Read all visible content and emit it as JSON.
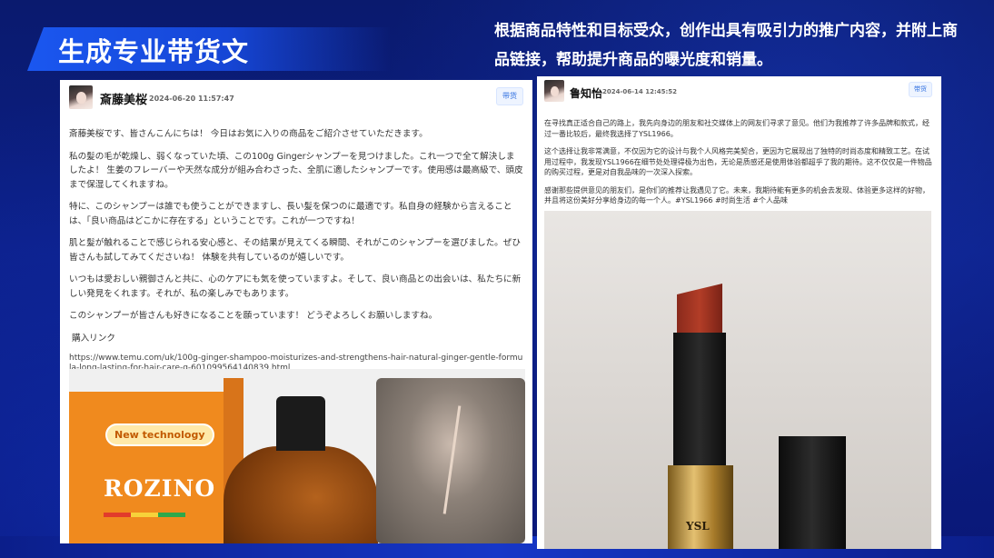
{
  "slide": {
    "title": "生成专业带货文",
    "description": "根据商品特性和目标受众，创作出具有吸引力的推广内容，并附上商品链接，帮助提升商品的曝光度和销量。"
  },
  "left_post": {
    "user_name": "斎藤美桜",
    "timestamp": "2024-06-20 11:57:47",
    "tag_label": "带货",
    "paragraphs": [
      "斎藤美桜です、皆さんこんにちは！ 今日はお気に入りの商品をご紹介させていただきます。",
      "私の髪の毛が乾燥し、弱くなっていた頃、この100g Gingerシャンプーを見つけました。これ一つで全て解決しましたよ！ 生姜のフレーバーや天然な成分が組み合わさった、全肌に適したシャンプーです。使用感は最高級で、頭皮まで保湿してくれますね。",
      "特に、このシャンプーは誰でも使うことができますし、長い髪を保つのに最適です。私自身の経験から言えることは、「良い商品はどこかに存在する」ということです。これが一つですね！",
      "肌と髪が触れることで感じられる安心感と、その結果が見えてくる瞬間、それがこのシャンプーを選びました。ぜひ皆さんも試してみてくださいね！ 体験を共有しているのが嬉しいです。",
      "いつもは愛おしい親御さんと共に、心のケアにも気を使っていますよ。そして、良い商品との出会いは、私たちに新しい発見をくれます。それが、私の楽しみでもあります。",
      "このシャンプーが皆さんも好きになることを願っています！ どうぞよろしくお願いしますね。"
    ],
    "link_label": "購入リンク",
    "link_url": "https://www.temu.com/uk/100g-ginger-shampoo-moisturizes-and-strengthens-hair-natural-ginger-gentle-formula-long-lasting-for-hair-care-g-601099564140839.html",
    "image": {
      "badge_text": "New technology",
      "brand_text": "ROZINO"
    }
  },
  "right_post": {
    "user_name": "鲁知怡",
    "timestamp": "2024-06-14 12:45:52",
    "tag_label": "带货",
    "paragraphs": [
      "在寻找真正适合自己的路上，我先向身边的朋友和社交媒体上的网友们寻求了意见。他们为我推荐了许多品牌和款式，经过一番比较后，最终我选择了YSL1966。",
      "这个选择让我非常满意，不仅因为它的设计与我个人风格完美契合，更因为它展现出了独特的时尚态度和精致工艺。在试用过程中，我发现YSL1966在细节处处理得极为出色，无论是质感还是使用体验都超乎了我的期待。这不仅仅是一件物品的购买过程，更是对自我品味的一次深入探索。",
      "感谢那些提供意见的朋友们，是你们的推荐让我遇见了它。未来，我期待能有更多的机会去发现、体验更多这样的好物，并且将这份美好分享给身边的每一个人。#YSL1966 #时尚生活 #个人品味"
    ],
    "image": {
      "brand_mark": "YSL"
    }
  },
  "colors": {
    "background": "#0c1f86",
    "banner": "#1a57f0",
    "accent_tag": "#2f6fe0",
    "product_box": "#f08a1e"
  }
}
